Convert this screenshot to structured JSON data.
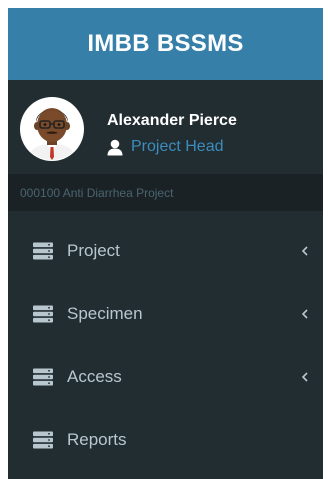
{
  "header": {
    "title": "IMBB BSSMS"
  },
  "user": {
    "name": "Alexander Pierce",
    "role": "Project Head",
    "role_icon": "user-icon",
    "avatar_icon": "avatar"
  },
  "project": {
    "label": "000100 Anti Diarrhea Project"
  },
  "menu": {
    "items": [
      {
        "label": "Project",
        "icon": "server-icon",
        "has_submenu": true
      },
      {
        "label": "Specimen",
        "icon": "server-icon",
        "has_submenu": true
      },
      {
        "label": "Access",
        "icon": "server-icon",
        "has_submenu": true
      },
      {
        "label": "Reports",
        "icon": "server-icon",
        "has_submenu": false
      }
    ]
  },
  "colors": {
    "header_bg": "#367fa9",
    "sidebar_bg": "#222d32",
    "project_bar_bg": "#1a2226",
    "accent": "#3c8dbc",
    "menu_text": "#b8c7ce"
  }
}
